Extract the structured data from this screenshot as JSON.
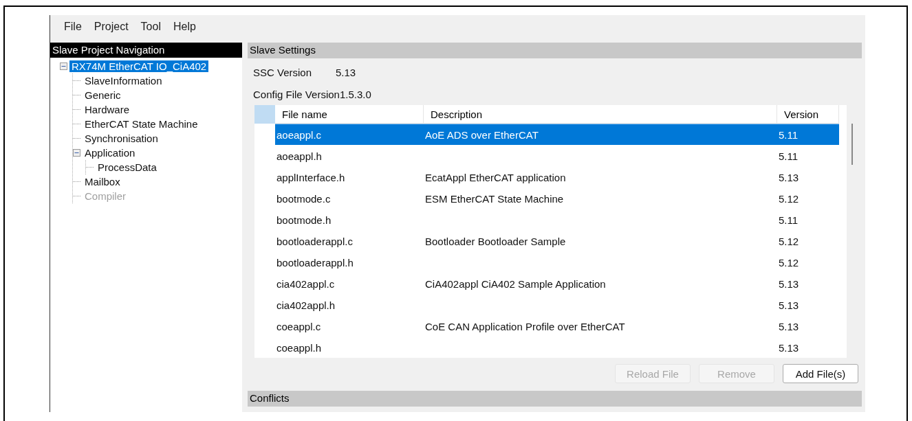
{
  "menu": [
    "File",
    "Project",
    "Tool",
    "Help"
  ],
  "navigation": {
    "title": "Slave Project Navigation",
    "tree": [
      {
        "label": "RX74M EtherCAT IO_CiA402",
        "selected": true,
        "disabled": false,
        "expanded": true,
        "children": [
          {
            "label": "SlaveInformation",
            "selected": false,
            "disabled": false
          },
          {
            "label": "Generic",
            "selected": false,
            "disabled": false
          },
          {
            "label": "Hardware",
            "selected": false,
            "disabled": false
          },
          {
            "label": "EtherCAT State Machine",
            "selected": false,
            "disabled": false
          },
          {
            "label": "Synchronisation",
            "selected": false,
            "disabled": false
          },
          {
            "label": "Application",
            "selected": false,
            "disabled": false,
            "expanded": true,
            "children": [
              {
                "label": "ProcessData",
                "selected": false,
                "disabled": false
              }
            ]
          },
          {
            "label": "Mailbox",
            "selected": false,
            "disabled": false
          },
          {
            "label": "Compiler",
            "selected": false,
            "disabled": true
          }
        ]
      }
    ]
  },
  "settings": {
    "title": "Slave Settings",
    "fields": [
      {
        "label": "SSC Version",
        "value": "5.13"
      },
      {
        "label": "Config File Version",
        "value": "1.5.3.0"
      }
    ],
    "table": {
      "columns": [
        "File name",
        "Description",
        "Version"
      ],
      "rows": [
        {
          "cells": [
            "aoeappl.c",
            "AoE ADS over EtherCAT",
            "5.11"
          ],
          "selected": true
        },
        {
          "cells": [
            "aoeappl.h",
            "",
            "5.11"
          ],
          "selected": false
        },
        {
          "cells": [
            "applInterface.h",
            "EcatAppl EtherCAT application",
            "5.13"
          ],
          "selected": false
        },
        {
          "cells": [
            "bootmode.c",
            "ESM EtherCAT State Machine",
            "5.12"
          ],
          "selected": false
        },
        {
          "cells": [
            "bootmode.h",
            "",
            "5.11"
          ],
          "selected": false
        },
        {
          "cells": [
            "bootloaderappl.c",
            "Bootloader Bootloader Sample",
            "5.12"
          ],
          "selected": false
        },
        {
          "cells": [
            "bootloaderappl.h",
            "",
            "5.12"
          ],
          "selected": false
        },
        {
          "cells": [
            "cia402appl.c",
            "CiA402appl CiA402 Sample Application",
            "5.13"
          ],
          "selected": false
        },
        {
          "cells": [
            "cia402appl.h",
            "",
            "5.13"
          ],
          "selected": false
        },
        {
          "cells": [
            "coeappl.c",
            "CoE CAN Application Profile over EtherCAT",
            "5.13"
          ],
          "selected": false
        },
        {
          "cells": [
            "coeappl.h",
            "",
            "5.13"
          ],
          "selected": false
        }
      ]
    },
    "buttons": [
      {
        "label": "Reload File",
        "disabled": true
      },
      {
        "label": "Remove",
        "disabled": true
      },
      {
        "label": "Add File(s)",
        "disabled": false
      }
    ]
  },
  "conflicts": {
    "title": "Conflicts"
  }
}
